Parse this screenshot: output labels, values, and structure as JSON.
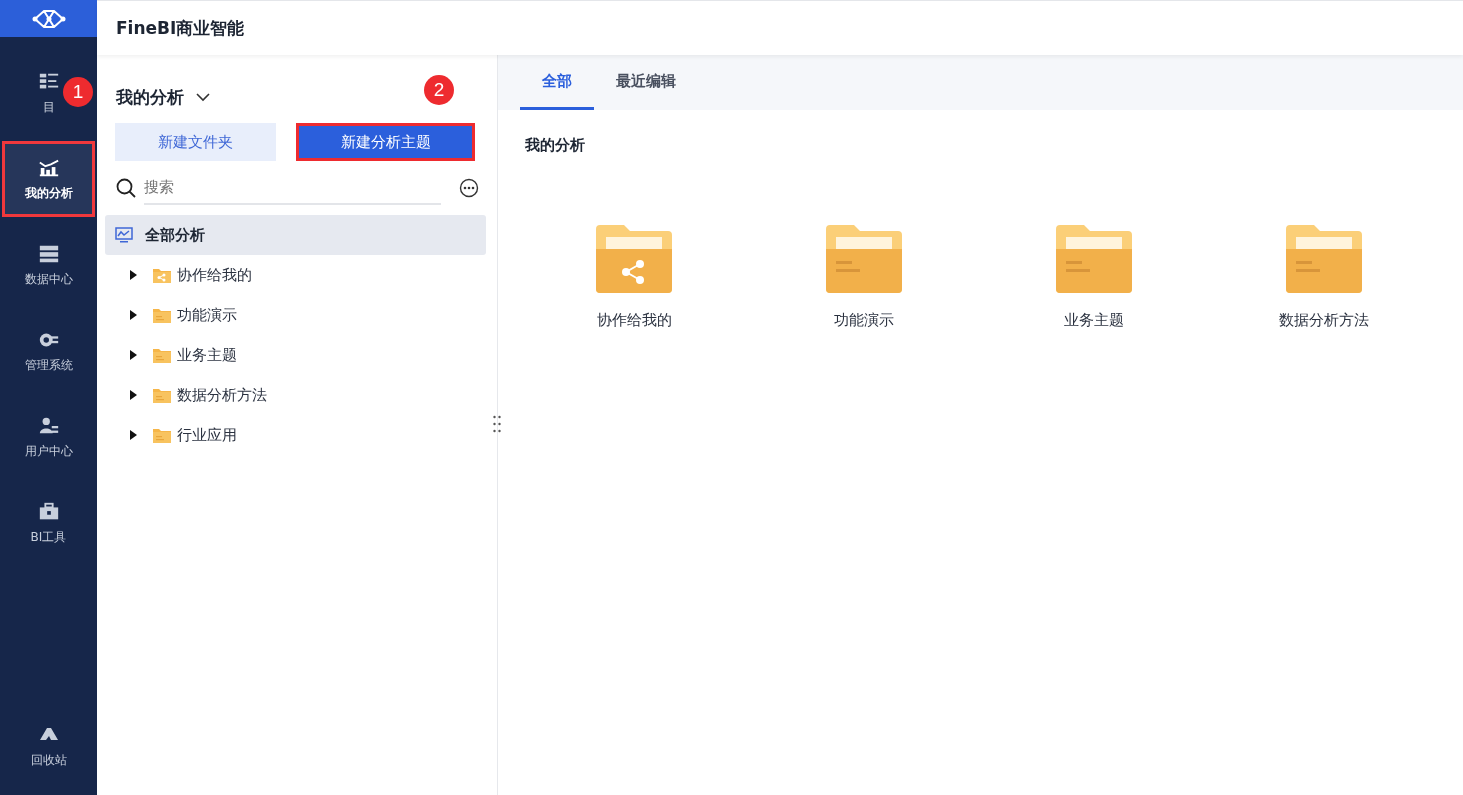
{
  "nav": {
    "items": [
      {
        "label": "目",
        "selected": false,
        "highlighted": false
      },
      {
        "label": "我的分析",
        "selected": true,
        "highlighted": true
      },
      {
        "label": "数据中心",
        "selected": false,
        "highlighted": false
      },
      {
        "label": "管理系统",
        "selected": false,
        "highlighted": false
      },
      {
        "label": "用户中心",
        "selected": false,
        "highlighted": false
      },
      {
        "label": "BI工具",
        "selected": false,
        "highlighted": false
      }
    ],
    "bottom": {
      "label": "回收站"
    }
  },
  "header": {
    "title": "FineBI商业智能"
  },
  "panel": {
    "title": "我的分析",
    "buttons": [
      {
        "label": "新建文件夹",
        "kind": "secondary",
        "highlighted": false
      },
      {
        "label": "新建分析主题",
        "kind": "primary",
        "highlighted": true
      }
    ],
    "search": {
      "placeholder": "搜索"
    },
    "tree": [
      {
        "label": "全部分析",
        "selected": true,
        "children": [
          {
            "label": "协作给我的",
            "kind": "shared",
            "expanded": false
          },
          {
            "label": "功能演示",
            "kind": "folder",
            "expanded": false
          },
          {
            "label": "业务主题",
            "kind": "folder",
            "expanded": false
          },
          {
            "label": "数据分析方法",
            "kind": "folder",
            "expanded": false
          },
          {
            "label": "行业应用",
            "kind": "folder",
            "expanded": false
          }
        ]
      }
    ]
  },
  "content": {
    "tabs": [
      {
        "label": "全部",
        "selected": true
      },
      {
        "label": "最近编辑",
        "selected": false
      }
    ],
    "section_title": "我的分析",
    "folders": [
      {
        "label": "协作给我的",
        "kind": "shared"
      },
      {
        "label": "功能演示",
        "kind": "folder"
      },
      {
        "label": "业务主题",
        "kind": "folder"
      },
      {
        "label": "数据分析方法",
        "kind": "folder"
      }
    ]
  },
  "annotations": [
    {
      "number": "1"
    },
    {
      "number": "2"
    }
  ]
}
